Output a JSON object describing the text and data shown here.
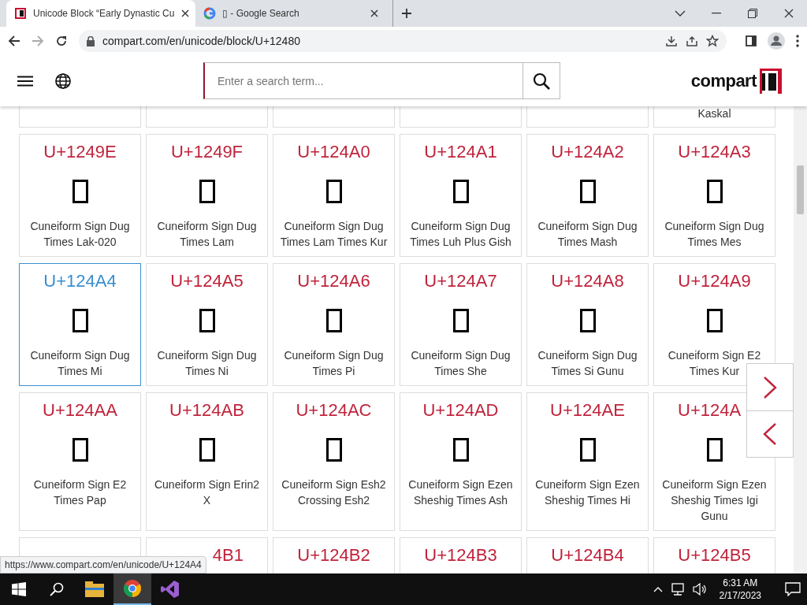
{
  "browser": {
    "tabs": [
      {
        "title": "Unicode Block “Early Dynastic Cu",
        "selected": true,
        "kind": "compart"
      },
      {
        "title": "▯ - Google Search",
        "selected": false,
        "kind": "google"
      }
    ],
    "url": "compart.com/en/unicode/block/U+12480"
  },
  "site": {
    "search": {
      "placeholder": "Enter a search term..."
    },
    "logo": "compart"
  },
  "top_row": [
    {
      "kind": "empty"
    },
    {
      "kind": "empty"
    },
    {
      "kind": "empty"
    },
    {
      "kind": "empty"
    },
    {
      "kind": "empty"
    },
    {
      "kind": "named",
      "name": "Kaskal"
    }
  ],
  "cards": [
    {
      "code": "U+1249E",
      "name": "Cuneiform Sign Dug Times Lak-020",
      "hovered": false
    },
    {
      "code": "U+1249F",
      "name": "Cuneiform Sign Dug Times Lam",
      "hovered": false
    },
    {
      "code": "U+124A0",
      "name": "Cuneiform Sign Dug Times Lam Times Kur",
      "hovered": false
    },
    {
      "code": "U+124A1",
      "name": "Cuneiform Sign Dug Times Luh Plus Gish",
      "hovered": false
    },
    {
      "code": "U+124A2",
      "name": "Cuneiform Sign Dug Times Mash",
      "hovered": false
    },
    {
      "code": "U+124A3",
      "name": "Cuneiform Sign Dug Times Mes",
      "hovered": false
    },
    {
      "code": "U+124A4",
      "name": "Cuneiform Sign Dug Times Mi",
      "hovered": true
    },
    {
      "code": "U+124A5",
      "name": "Cuneiform Sign Dug Times Ni",
      "hovered": false
    },
    {
      "code": "U+124A6",
      "name": "Cuneiform Sign Dug Times Pi",
      "hovered": false
    },
    {
      "code": "U+124A7",
      "name": "Cuneiform Sign Dug Times She",
      "hovered": false
    },
    {
      "code": "U+124A8",
      "name": "Cuneiform Sign Dug Times Si Gunu",
      "hovered": false
    },
    {
      "code": "U+124A9",
      "name": "Cuneiform Sign E2 Times Kur",
      "hovered": false
    },
    {
      "code": "U+124AA",
      "name": "Cuneiform Sign E2 Times Pap",
      "hovered": false
    },
    {
      "code": "U+124AB",
      "name": "Cuneiform Sign Erin2 X",
      "hovered": false
    },
    {
      "code": "U+124AC",
      "name": "Cuneiform Sign Esh2 Crossing Esh2",
      "hovered": false
    },
    {
      "code": "U+124AD",
      "name": "Cuneiform Sign Ezen Sheshig Times Ash",
      "hovered": false
    },
    {
      "code": "U+124AE",
      "name": "Cuneiform Sign Ezen Sheshig Times Hi",
      "hovered": false
    },
    {
      "code": "U+124A",
      "name": "Cuneiform Sign Ezen Sheshig Times Igi Gunu",
      "hovered": false,
      "kind": "cut_end"
    }
  ],
  "bottom_row": [
    {
      "kind": "empty"
    },
    {
      "kind": "cut_start",
      "code": "4B1"
    },
    {
      "kind": "full",
      "code": "U+124B2"
    },
    {
      "kind": "full",
      "code": "U+124B3"
    },
    {
      "kind": "full",
      "code": "U+124B4"
    },
    {
      "kind": "full",
      "code": "U+124B5"
    }
  ],
  "status_url": "https://www.compart.com/en/unicode/U+124A4",
  "taskbar": {
    "apps": [
      {
        "kind": "explorer",
        "active": false
      },
      {
        "kind": "chrome",
        "active": true
      },
      {
        "kind": "vs",
        "active": false
      }
    ],
    "time": "6:31 AM",
    "date": "2/17/2023"
  }
}
